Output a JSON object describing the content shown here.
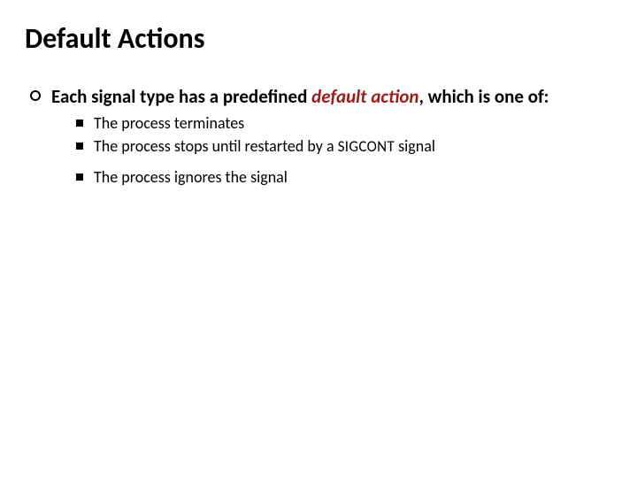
{
  "title": "Default Actions",
  "lead": {
    "pre": "Each signal type has a predefined ",
    "em": "default action",
    "post": ", which is one of:"
  },
  "items": {
    "a": "The process terminates",
    "b_pre": "The process stops until restarted by a ",
    "b_sig": "SIGCONT",
    "b_post": " signal",
    "c": "The process ignores the signal"
  }
}
